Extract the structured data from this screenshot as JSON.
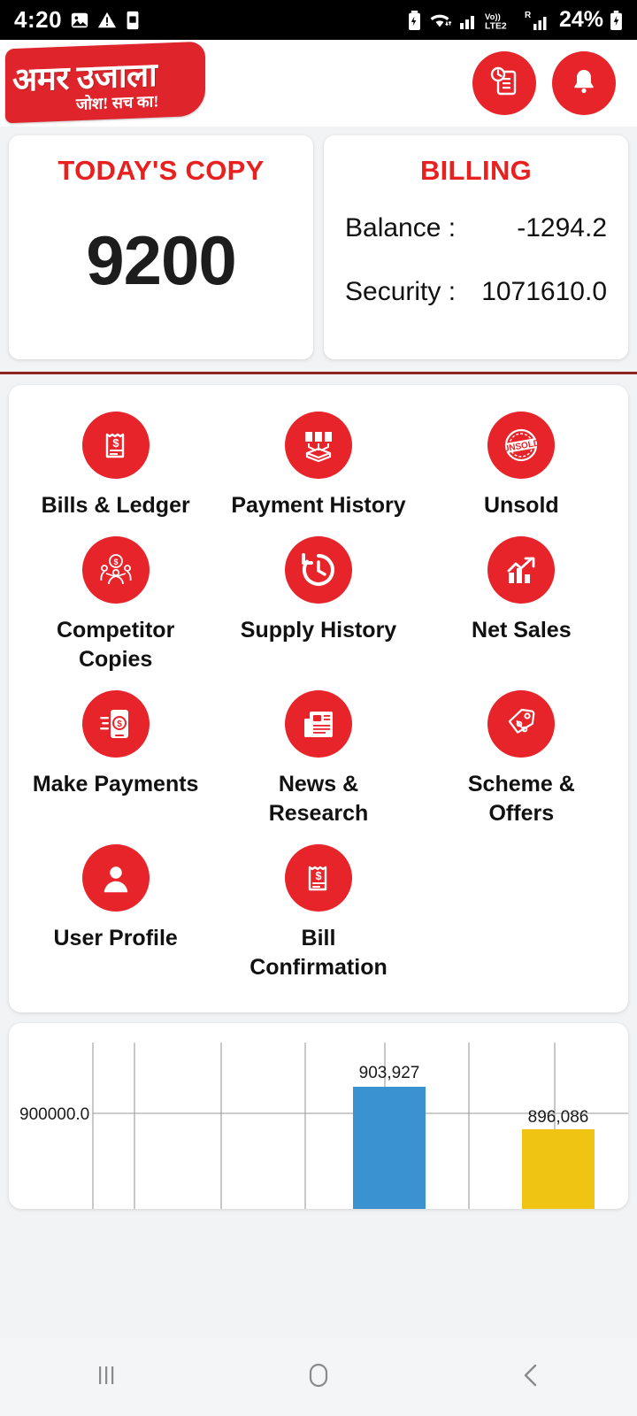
{
  "status_bar": {
    "time": "4:20",
    "battery_percent": "24%",
    "network_label": "LTE2",
    "volte_label": "Vo))",
    "roaming_label": "R",
    "left_icons": [
      "image-icon",
      "warning-icon",
      "sim-card-icon"
    ],
    "right_icons": [
      "battery-saver-icon",
      "wifi-icon",
      "signal-icon",
      "volte-icon",
      "roaming-signal-icon",
      "charging-battery-icon"
    ]
  },
  "header": {
    "logo_text": "अमर उजाला",
    "logo_tagline": "जोश! सच का!",
    "logo_color": "#e0242b",
    "buttons": [
      {
        "name": "report-button",
        "icon": "document-clock-icon"
      },
      {
        "name": "notification-button",
        "icon": "bell-icon"
      }
    ]
  },
  "stats": {
    "todays_copy": {
      "title": "TODAY'S COPY",
      "value": "9200"
    },
    "billing": {
      "title": "BILLING",
      "balance_label": "Balance :",
      "balance_value": "-1294.2",
      "security_label": "Security :",
      "security_value": "1071610.0"
    },
    "title_color": "#e8201f"
  },
  "menu": {
    "items": [
      {
        "label": "Bills & Ledger",
        "icon": "receipt-dollar-icon"
      },
      {
        "label": "Payment History",
        "icon": "documents-tray-icon"
      },
      {
        "label": "Unsold",
        "icon": "unsold-stamp-icon"
      },
      {
        "label": "Competitor Copies",
        "icon": "people-coin-icon"
      },
      {
        "label": "Supply History",
        "icon": "clock-history-icon"
      },
      {
        "label": "Net Sales",
        "icon": "bar-chart-arrow-icon"
      },
      {
        "label": "Make Payments",
        "icon": "mobile-payment-icon"
      },
      {
        "label": "News & Research",
        "icon": "newspaper-icon"
      },
      {
        "label": "Scheme & Offers",
        "icon": "price-tag-percent-icon"
      },
      {
        "label": "User Profile",
        "icon": "user-avatar-icon"
      },
      {
        "label": "Bill Confirmation",
        "icon": "receipt-dollar-icon"
      }
    ],
    "icon_color": "#e8242b"
  },
  "chart_data": {
    "type": "bar",
    "title": "",
    "xlabel": "",
    "ylabel": "",
    "categories": [
      "",
      "",
      "",
      "",
      "Blue",
      "",
      "Yellow"
    ],
    "values": [
      null,
      null,
      null,
      null,
      903927,
      null,
      896086
    ],
    "bars": [
      {
        "label": "903,927",
        "value": 903927,
        "color": "#3a92d0"
      },
      {
        "label": "896,086",
        "value": 896086,
        "color": "#f0c413"
      }
    ],
    "y_tick_labels": [
      "900000.0"
    ],
    "y_ticks": [
      900000
    ],
    "grid": true,
    "gridline_count": 7,
    "legend": "none",
    "axis_label_color": "#1a1a1a"
  },
  "navbar": {
    "buttons": [
      {
        "name": "recents-button",
        "icon": "recents-icon"
      },
      {
        "name": "home-button",
        "icon": "home-circle-icon"
      },
      {
        "name": "back-button",
        "icon": "back-chevron-icon"
      }
    ]
  }
}
